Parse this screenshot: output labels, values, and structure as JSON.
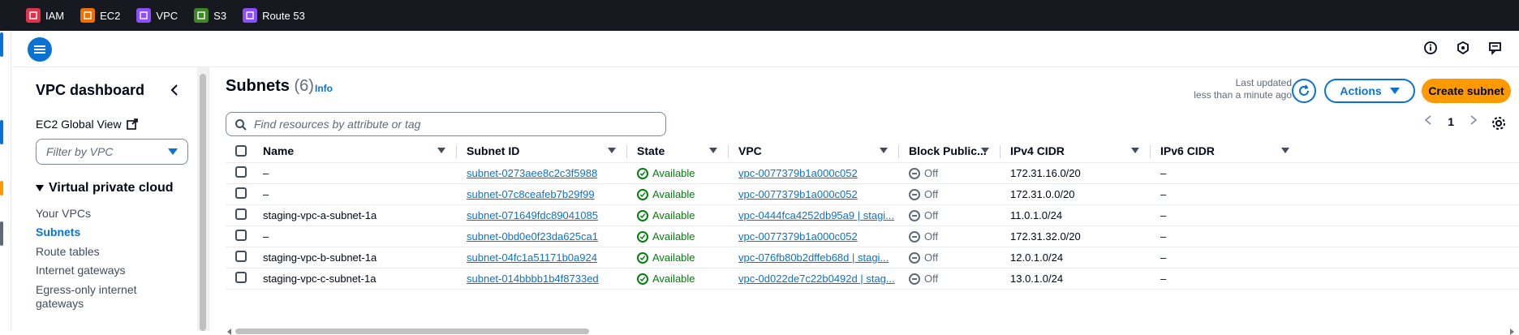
{
  "favorites": [
    {
      "label": "IAM",
      "icon": "iam-icon",
      "color": "#dd344c"
    },
    {
      "label": "EC2",
      "icon": "ec2-icon",
      "color": "#ed7100"
    },
    {
      "label": "VPC",
      "icon": "vpc-icon",
      "color": "#8c4fff"
    },
    {
      "label": "S3",
      "icon": "s3-icon",
      "color": "#3f8624"
    },
    {
      "label": "Route 53",
      "icon": "route53-icon",
      "color": "#8c4fff"
    }
  ],
  "sidebar": {
    "title": "VPC dashboard",
    "ec2_global_view": "EC2 Global View",
    "filter_placeholder": "Filter by VPC",
    "section": "Virtual private cloud",
    "items": [
      {
        "label": "Your VPCs",
        "active": false
      },
      {
        "label": "Subnets",
        "active": true
      },
      {
        "label": "Route tables",
        "active": false
      },
      {
        "label": "Internet gateways",
        "active": false
      },
      {
        "label": "Egress-only internet",
        "active": false
      },
      {
        "label": "gateways",
        "active": false
      }
    ]
  },
  "header": {
    "title": "Subnets",
    "count": "(6)",
    "info": "Info",
    "last_updated_1": "Last updated",
    "last_updated_2": "less than a minute ago",
    "actions": "Actions",
    "create": "Create subnet"
  },
  "search": {
    "placeholder": "Find resources by attribute or tag"
  },
  "pagination": {
    "page": "1"
  },
  "table": {
    "columns": [
      "Name",
      "Subnet ID",
      "State",
      "VPC",
      "Block Public...",
      "IPv4 CIDR",
      "IPv6 CIDR"
    ],
    "rows": [
      {
        "name": "–",
        "subnet_id": "subnet-0273aee8c2c3f5988",
        "state": "Available",
        "vpc": "vpc-0077379b1a000c052",
        "block": "Off",
        "ipv4": "172.31.16.0/20",
        "ipv6": "–"
      },
      {
        "name": "–",
        "subnet_id": "subnet-07c8ceafeb7b29f99",
        "state": "Available",
        "vpc": "vpc-0077379b1a000c052",
        "block": "Off",
        "ipv4": "172.31.0.0/20",
        "ipv6": "–"
      },
      {
        "name": "staging-vpc-a-subnet-1a",
        "subnet_id": "subnet-071649fdc89041085",
        "state": "Available",
        "vpc": "vpc-0444fca4252db95a9 | stagi...",
        "block": "Off",
        "ipv4": "11.0.1.0/24",
        "ipv6": "–"
      },
      {
        "name": "–",
        "subnet_id": "subnet-0bd0e0f23da625ca1",
        "state": "Available",
        "vpc": "vpc-0077379b1a000c052",
        "block": "Off",
        "ipv4": "172.31.32.0/20",
        "ipv6": "–"
      },
      {
        "name": "staging-vpc-b-subnet-1a",
        "subnet_id": "subnet-04fc1a51171b0a924",
        "state": "Available",
        "vpc": "vpc-076fb80b2dffeb68d | stagi...",
        "block": "Off",
        "ipv4": "12.0.1.0/24",
        "ipv6": "–"
      },
      {
        "name": "staging-vpc-c-subnet-1a",
        "subnet_id": "subnet-014bbbb1b4f8733ed",
        "state": "Available",
        "vpc": "vpc-0d022de7c22b0492d | stag...",
        "block": "Off",
        "ipv4": "13.0.1.0/24",
        "ipv6": "–"
      }
    ]
  },
  "colors": {
    "accent": "#0972d3",
    "primary_button": "#ff9900",
    "success": "#037f0c",
    "topbar": "#16191f"
  }
}
